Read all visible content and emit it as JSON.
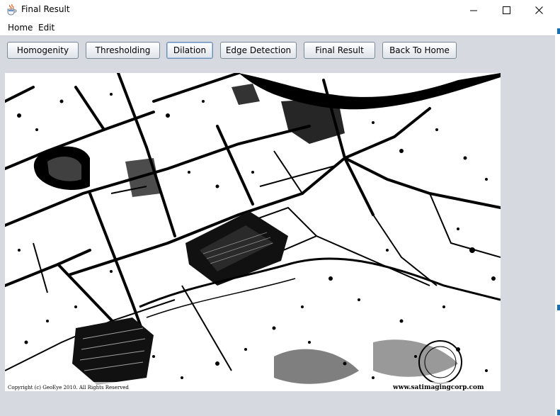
{
  "window": {
    "title": "Final Result",
    "icon": "java-cup-icon"
  },
  "menu": {
    "items": [
      "Home",
      "Edit"
    ]
  },
  "toolbar": {
    "buttons": [
      {
        "label": "Homogenity"
      },
      {
        "label": "Thresholding"
      },
      {
        "label": "Dilation",
        "focused": true
      },
      {
        "label": "Edge Detection"
      },
      {
        "label": "Final Result"
      },
      {
        "label": "Back To Home"
      }
    ]
  },
  "image": {
    "description_icon": "binary-satellite-image",
    "copyright_text": "Copyright (c) GeoEye 2010. All Rights Reserved",
    "watermark_text": "www.satimagingcorp.com"
  },
  "colors": {
    "window_bg": "#d6d9df",
    "focus_border": "#6b8fb8"
  }
}
